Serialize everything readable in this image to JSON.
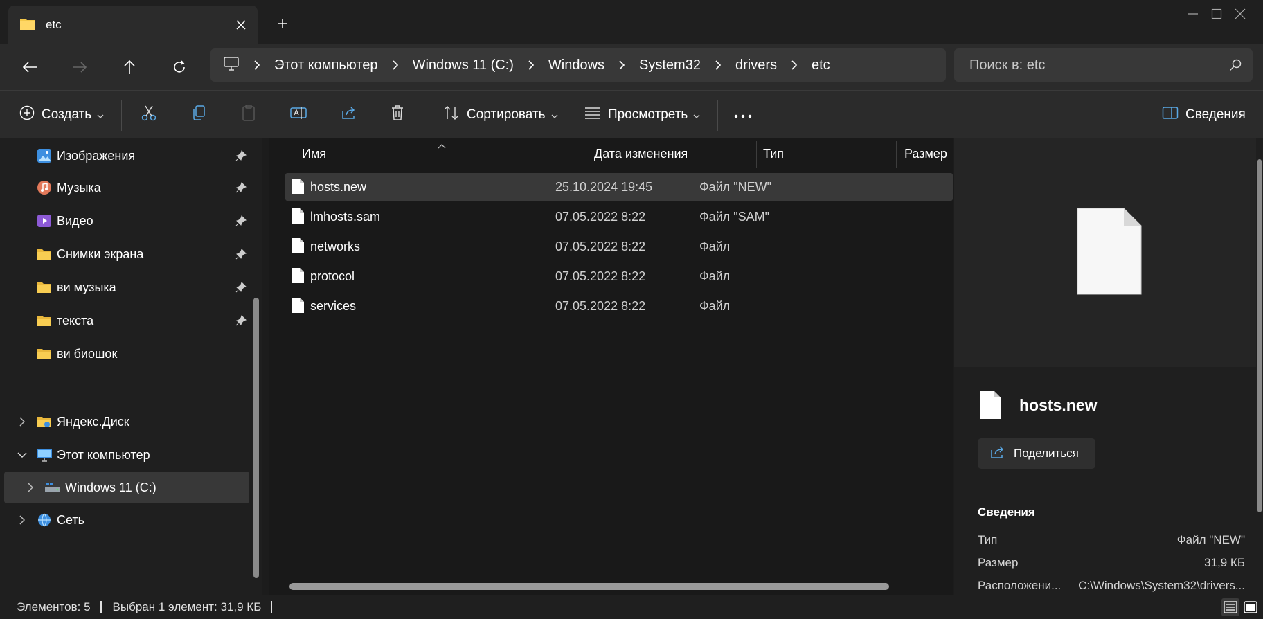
{
  "window": {
    "tab_title": "etc",
    "colors": {
      "background": "#191919",
      "panel": "#2b2b2b",
      "selected": "#393939",
      "folder": "#f4c84a"
    }
  },
  "address": {
    "crumbs": [
      "Этот компьютер",
      "Windows 11 (C:)",
      "Windows",
      "System32",
      "drivers",
      "etc"
    ]
  },
  "search": {
    "placeholder": "Поиск в: etc"
  },
  "toolbar": {
    "create_label": "Создать",
    "sort_label": "Сортировать",
    "view_label": "Просмотреть",
    "details_label": "Сведения"
  },
  "sidebar": {
    "pinned": [
      {
        "label": "Изображения",
        "icon": "pictures-icon"
      },
      {
        "label": "Музыка",
        "icon": "music-icon"
      },
      {
        "label": "Видео",
        "icon": "video-icon"
      },
      {
        "label": "Снимки экрана",
        "icon": "folder-icon"
      },
      {
        "label": "ви музыка",
        "icon": "folder-icon"
      },
      {
        "label": "текста",
        "icon": "folder-icon"
      },
      {
        "label": "ви биошок",
        "icon": "folder-icon"
      }
    ],
    "tree": [
      {
        "label": "Яндекс.Диск",
        "icon": "yandex-disk-icon"
      },
      {
        "label": "Этот компьютер",
        "icon": "computer-icon"
      },
      {
        "label": "Windows 11 (C:)",
        "icon": "drive-icon"
      },
      {
        "label": "Сеть",
        "icon": "network-icon"
      }
    ]
  },
  "filelist": {
    "columns": {
      "name": "Имя",
      "date": "Дата изменения",
      "type": "Тип",
      "size": "Размер"
    },
    "rows": [
      {
        "name": "hosts.new",
        "date": "25.10.2024 19:45",
        "type": "Файл \"NEW\""
      },
      {
        "name": "lmhosts.sam",
        "date": "07.05.2022 8:22",
        "type": "Файл \"SAM\""
      },
      {
        "name": "networks",
        "date": "07.05.2022 8:22",
        "type": "Файл"
      },
      {
        "name": "protocol",
        "date": "07.05.2022 8:22",
        "type": "Файл"
      },
      {
        "name": "services",
        "date": "07.05.2022 8:22",
        "type": "Файл"
      }
    ]
  },
  "details": {
    "file_name": "hosts.new",
    "share_label": "Поделиться",
    "section_title": "Сведения",
    "props": [
      {
        "key": "Тип",
        "value": "Файл \"NEW\""
      },
      {
        "key": "Размер",
        "value": "31,9 КБ"
      },
      {
        "key": "Расположени...",
        "value": "C:\\Windows\\System32\\drivers..."
      }
    ]
  },
  "status": {
    "count": "Элементов: 5",
    "selection": "Выбран 1 элемент: 31,9 КБ"
  }
}
